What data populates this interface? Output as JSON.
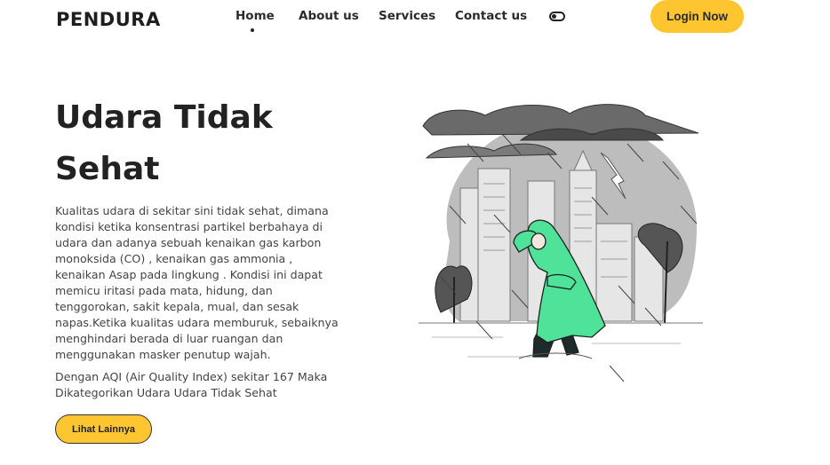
{
  "brand": {
    "name": "PENDURA"
  },
  "nav": {
    "items": [
      {
        "label": "Home",
        "active": true
      },
      {
        "label": "About us",
        "active": false
      },
      {
        "label": "Services",
        "active": false
      },
      {
        "label": "Contact us",
        "active": false
      }
    ],
    "theme_toggle_icon": "toggle-icon",
    "login_label": "Login Now"
  },
  "hero": {
    "title": "Udara Tidak Sehat",
    "description": "Kualitas udara di sekitar sini tidak sehat, dimana kondisi ketika konsentrasi partikel berbahaya di udara dan adanya sebuah kenaikan gas karbon monoksida (CO) , kenaikan gas ammonia , kenaikan Asap pada lingkung . Kondisi ini dapat memicu iritasi pada mata, hidung, dan tenggorokan, sakit kepala, mual, dan sesak napas.Ketika kualitas udara memburuk, sebaiknya menghindari berada di luar ruangan dan menggunakan masker penutup wajah.",
    "aqi_text": "Dengan AQI (Air Quality Index) sekitar 167 Maka Dikategorikan Udara Udara Tidak Sehat",
    "button_label": "Lihat Lainnya",
    "illustration": "storm-person-raincoat-illustration"
  },
  "colors": {
    "accent": "#fdc530",
    "raincoat": "#4fe39a",
    "text_dark": "#222222"
  }
}
